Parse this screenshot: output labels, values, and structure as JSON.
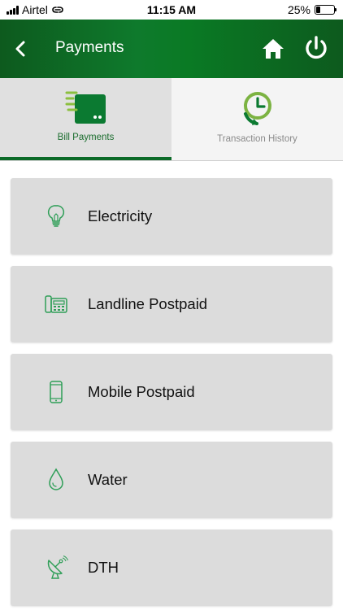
{
  "status_bar": {
    "carrier": "Airtel",
    "time": "11:15 AM",
    "battery": "25%",
    "battery_level": 0.25
  },
  "header": {
    "title": "Payments",
    "back_icon": "chevron-left-icon",
    "home_icon": "home-icon",
    "power_icon": "power-icon"
  },
  "tabs": [
    {
      "label": "Bill Payments",
      "icon": "bill-payment-icon",
      "active": true
    },
    {
      "label": "Transaction History",
      "icon": "clock-history-icon",
      "active": false
    }
  ],
  "bill_items": [
    {
      "label": "Electricity",
      "icon": "light-bulb-icon"
    },
    {
      "label": "Landline Postpaid",
      "icon": "telephone-icon"
    },
    {
      "label": "Mobile Postpaid",
      "icon": "mobile-phone-icon"
    },
    {
      "label": "Water",
      "icon": "water-drop-icon"
    },
    {
      "label": "DTH",
      "icon": "satellite-dish-icon"
    }
  ],
  "colors": {
    "brand_green": "#0e7a2c",
    "icon_green": "#2e9e57",
    "tab_label_active": "#1b6d2e",
    "tab_label_inactive": "#8a8a8a",
    "card_bg": "#dcdcdc"
  }
}
